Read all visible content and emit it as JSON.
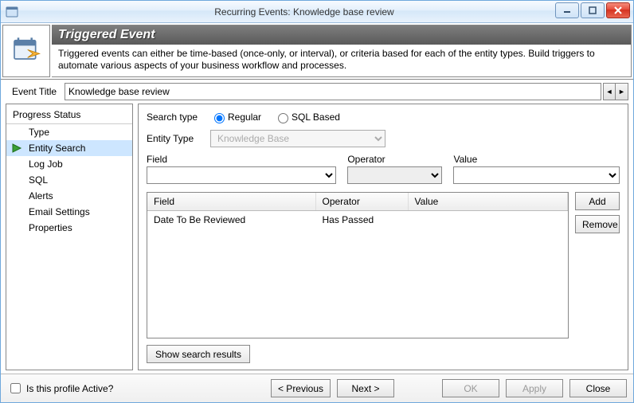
{
  "window": {
    "title": "Recurring Events: Knowledge base review"
  },
  "header": {
    "title": "Triggered Event",
    "description": "Triggered events can either be time-based (once-only, or interval), or criteria based for each of the entity types.  Build triggers to automate various aspects of your business workflow and processes."
  },
  "event_title": {
    "label": "Event Title",
    "value": "Knowledge base review"
  },
  "sidebar": {
    "header": "Progress Status",
    "items": [
      {
        "label": "Type"
      },
      {
        "label": "Entity Search"
      },
      {
        "label": "Log Job"
      },
      {
        "label": "SQL"
      },
      {
        "label": "Alerts"
      },
      {
        "label": "Email Settings"
      },
      {
        "label": "Properties"
      }
    ],
    "selected_index": 1
  },
  "search": {
    "search_type_label": "Search type",
    "regular_label": "Regular",
    "sql_label": "SQL Based",
    "selected_type": "regular",
    "entity_type_label": "Entity Type",
    "entity_type_value": "Knowledge Base",
    "field_label": "Field",
    "operator_label": "Operator",
    "value_label": "Value",
    "field_value": "",
    "operator_value": "",
    "value_value": ""
  },
  "criteria_grid": {
    "columns": {
      "field": "Field",
      "operator": "Operator",
      "value": "Value"
    },
    "rows": [
      {
        "field": "Date To Be Reviewed",
        "operator": "Has Passed",
        "value": ""
      }
    ]
  },
  "buttons": {
    "add": "Add",
    "remove": "Remove",
    "show_results": "Show search results",
    "previous": "< Previous",
    "next": "Next >",
    "ok": "OK",
    "apply": "Apply",
    "close": "Close"
  },
  "footer": {
    "active_label": "Is this profile Active?",
    "active_checked": false
  }
}
